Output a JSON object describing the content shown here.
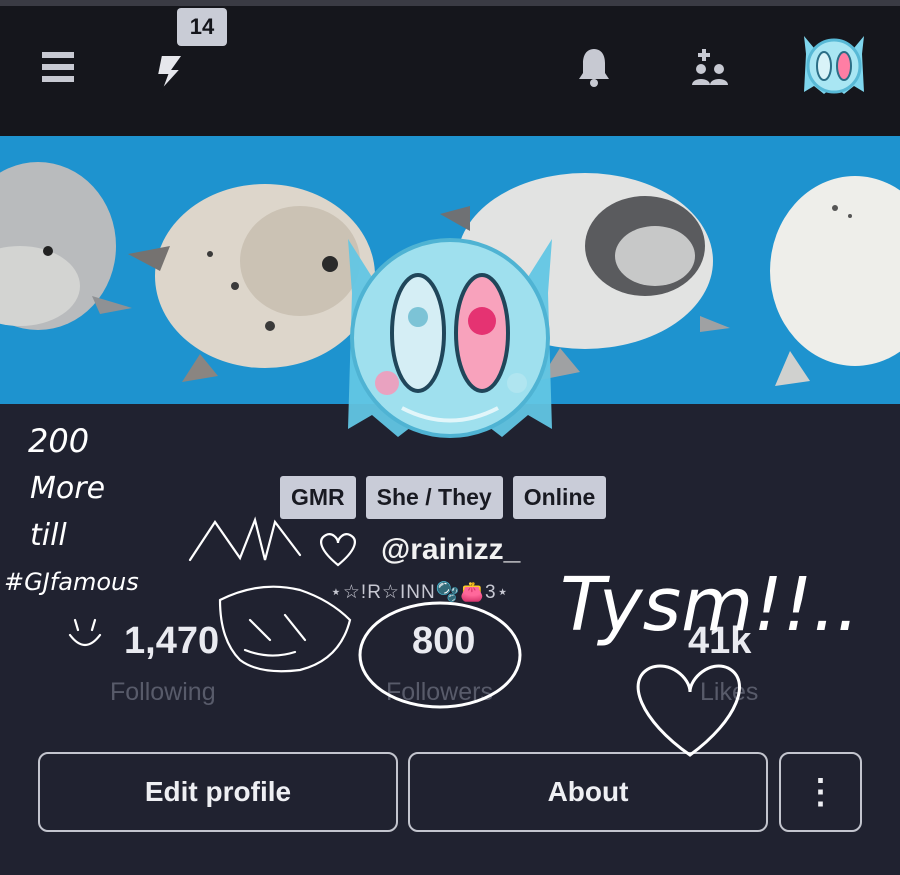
{
  "header": {
    "notification_count": "14",
    "icons": [
      "menu-icon",
      "lightning-icon",
      "bell-icon",
      "add-friend-icon",
      "avatar"
    ]
  },
  "profile": {
    "tags": [
      "GMR",
      "She / They",
      "Online"
    ],
    "username": "@rainizz_",
    "subtitle": "⋆☆!R☆INN🫧👛3⋆",
    "stats": [
      {
        "value": "1,470",
        "label": "Following"
      },
      {
        "value": "800",
        "label": "Followers"
      },
      {
        "value": "41k",
        "label": "Likes"
      }
    ]
  },
  "actions": {
    "edit_label": "Edit profile",
    "about_label": "About",
    "more_label": "⋮"
  },
  "doodle_text": {
    "left": [
      "200",
      "More",
      "till",
      "#GJfamous"
    ],
    "right": "Tysm!!.."
  },
  "colors": {
    "banner": "#1e93cf",
    "background": "#202230",
    "topbar": "#15161c"
  }
}
